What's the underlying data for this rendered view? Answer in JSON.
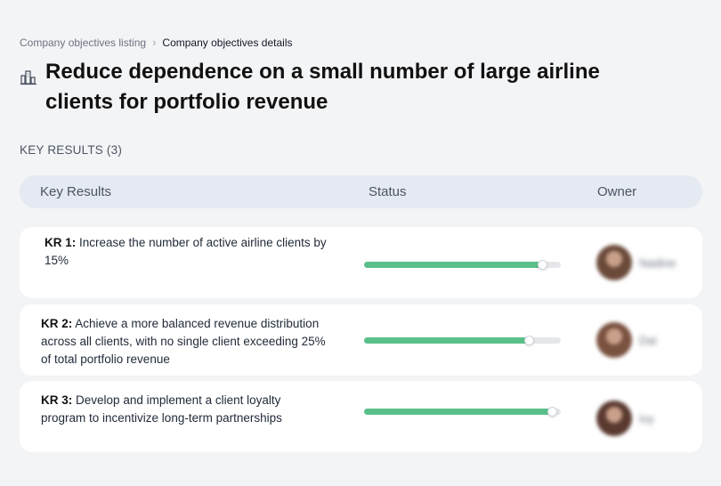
{
  "breadcrumb": {
    "parent": "Company objectives listing",
    "separator": "›",
    "current": "Company objectives details"
  },
  "objective": {
    "title": "Reduce dependence on a small number of large airline clients for portfolio revenue",
    "icon": "building-chart-icon"
  },
  "key_results_section": {
    "label": "KEY RESULTS (3)"
  },
  "table": {
    "columns": [
      "Key Results",
      "Status",
      "Owner"
    ]
  },
  "key_results": [
    {
      "id": "KR 1:",
      "text": "Increase the number of active airline clients by 15%",
      "progress": 0.91,
      "owner": {
        "name": "Nadine",
        "avatar_color": "#6b4a3a"
      }
    },
    {
      "id": "KR 2:",
      "text": "Achieve a more balanced revenue distribution across all clients, with no single client exceeding 25% of total portfolio revenue",
      "progress": 0.84,
      "owner": {
        "name": "Dai",
        "avatar_color": "#7a5240"
      }
    },
    {
      "id": "KR 3:",
      "text": "Develop and implement a client loyalty program to incentivize long-term partnerships",
      "progress": 0.96,
      "owner": {
        "name": "Ivy",
        "avatar_color": "#5a3a30"
      }
    }
  ],
  "colors": {
    "progress_fill": "#5bbf8a",
    "progress_track": "#e5e7eb",
    "background": "#f3f4f6",
    "header_bg": "#e5e9f1"
  }
}
